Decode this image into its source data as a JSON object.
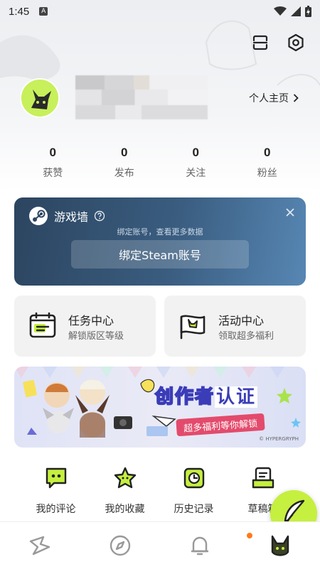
{
  "status_bar": {
    "time": "1:45",
    "app_indicator": "A"
  },
  "profile": {
    "home_link": "个人主页"
  },
  "stats": [
    {
      "value": "0",
      "label": "获赞"
    },
    {
      "value": "0",
      "label": "发布"
    },
    {
      "value": "0",
      "label": "关注"
    },
    {
      "value": "0",
      "label": "粉丝"
    }
  ],
  "steam_card": {
    "title": "游戏墙",
    "subtitle": "绑定账号，查看更多数据",
    "button_label": "绑定Steam账号"
  },
  "cards": [
    {
      "title": "任务中心",
      "subtitle": "解锁版区等级",
      "icon": "calendar-task-icon"
    },
    {
      "title": "活动中心",
      "subtitle": "领取超多福利",
      "icon": "flag-icon"
    }
  ],
  "banner": {
    "title_a": "创作者",
    "title_b": "认证",
    "subtitle": "超多福利等你解锁",
    "copyright": "© HYPERGRYPH"
  },
  "quick_actions": [
    {
      "label": "我的评论",
      "icon": "comment-icon"
    },
    {
      "label": "我的收藏",
      "icon": "star-icon"
    },
    {
      "label": "历史记录",
      "icon": "history-icon"
    },
    {
      "label": "草稿箱",
      "icon": "drafts-icon"
    }
  ],
  "colors": {
    "accent": "#c5f03f",
    "steam_card_start": "#2c4560",
    "steam_card_end": "#5787b4",
    "notification_dot": "#ff7a1a"
  }
}
